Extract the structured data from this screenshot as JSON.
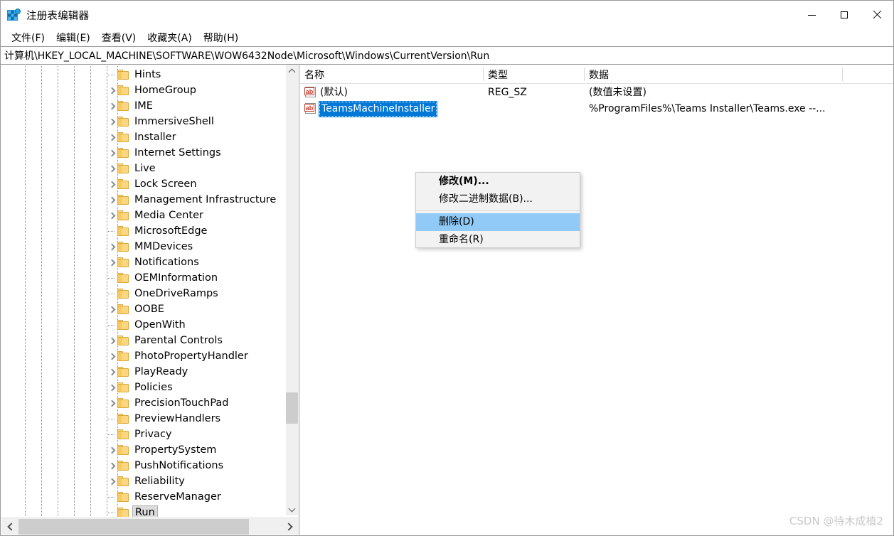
{
  "window": {
    "title": "注册表编辑器",
    "icon": "registry-editor-icon",
    "controls": {
      "minimize": "—",
      "maximize": "□",
      "close": "✕"
    }
  },
  "menubar": {
    "items": [
      {
        "label": "文件(F)"
      },
      {
        "label": "编辑(E)"
      },
      {
        "label": "查看(V)"
      },
      {
        "label": "收藏夹(A)"
      },
      {
        "label": "帮助(H)"
      }
    ]
  },
  "address": {
    "value": "计算机\\HKEY_LOCAL_MACHINE\\SOFTWARE\\WOW6432Node\\Microsoft\\Windows\\CurrentVersion\\Run"
  },
  "tree": {
    "items": [
      {
        "label": "Hints",
        "expandable": false,
        "selected": false
      },
      {
        "label": "HomeGroup",
        "expandable": true,
        "selected": false
      },
      {
        "label": "IME",
        "expandable": true,
        "selected": false
      },
      {
        "label": "ImmersiveShell",
        "expandable": true,
        "selected": false
      },
      {
        "label": "Installer",
        "expandable": true,
        "selected": false
      },
      {
        "label": "Internet Settings",
        "expandable": true,
        "selected": false
      },
      {
        "label": "Live",
        "expandable": true,
        "selected": false
      },
      {
        "label": "Lock Screen",
        "expandable": true,
        "selected": false
      },
      {
        "label": "Management Infrastructure",
        "expandable": true,
        "selected": false
      },
      {
        "label": "Media Center",
        "expandable": true,
        "selected": false
      },
      {
        "label": "MicrosoftEdge",
        "expandable": false,
        "selected": false
      },
      {
        "label": "MMDevices",
        "expandable": true,
        "selected": false
      },
      {
        "label": "Notifications",
        "expandable": true,
        "selected": false
      },
      {
        "label": "OEMInformation",
        "expandable": false,
        "selected": false
      },
      {
        "label": "OneDriveRamps",
        "expandable": false,
        "selected": false
      },
      {
        "label": "OOBE",
        "expandable": true,
        "selected": false
      },
      {
        "label": "OpenWith",
        "expandable": false,
        "selected": false
      },
      {
        "label": "Parental Controls",
        "expandable": true,
        "selected": false
      },
      {
        "label": "PhotoPropertyHandler",
        "expandable": true,
        "selected": false
      },
      {
        "label": "PlayReady",
        "expandable": true,
        "selected": false
      },
      {
        "label": "Policies",
        "expandable": true,
        "selected": false
      },
      {
        "label": "PrecisionTouchPad",
        "expandable": true,
        "selected": false
      },
      {
        "label": "PreviewHandlers",
        "expandable": false,
        "selected": false
      },
      {
        "label": "Privacy",
        "expandable": false,
        "selected": false
      },
      {
        "label": "PropertySystem",
        "expandable": true,
        "selected": false
      },
      {
        "label": "PushNotifications",
        "expandable": true,
        "selected": false
      },
      {
        "label": "Reliability",
        "expandable": true,
        "selected": false
      },
      {
        "label": "ReserveManager",
        "expandable": false,
        "selected": false
      },
      {
        "label": "Run",
        "expandable": false,
        "selected": true
      }
    ]
  },
  "list": {
    "columns": [
      {
        "label": "名称"
      },
      {
        "label": "类型"
      },
      {
        "label": "数据"
      }
    ],
    "rows": [
      {
        "name": "(默认)",
        "type": "REG_SZ",
        "data": "(数值未设置)",
        "icon": "string-value-icon",
        "selected": false
      },
      {
        "name": "TeamsMachineInstaller",
        "type": "",
        "data": "%ProgramFiles%\\Teams Installer\\Teams.exe --...",
        "icon": "string-value-icon",
        "selected": true
      }
    ]
  },
  "context_menu": {
    "items": [
      {
        "label": "修改(M)...",
        "bold": true,
        "highlighted": false
      },
      {
        "label": "修改二进制数据(B)...",
        "bold": false,
        "highlighted": false
      },
      {
        "separator": true
      },
      {
        "label": "删除(D)",
        "bold": false,
        "highlighted": true
      },
      {
        "label": "重命名(R)",
        "bold": false,
        "highlighted": false
      }
    ]
  },
  "watermark": {
    "text": "CSDN @待木成植2"
  },
  "colors": {
    "selection_blue": "#0078d7",
    "menu_highlight": "#91c9f7",
    "folder_yellow": "#fcd77f",
    "tree_selected_gray": "#dcdcdc"
  }
}
